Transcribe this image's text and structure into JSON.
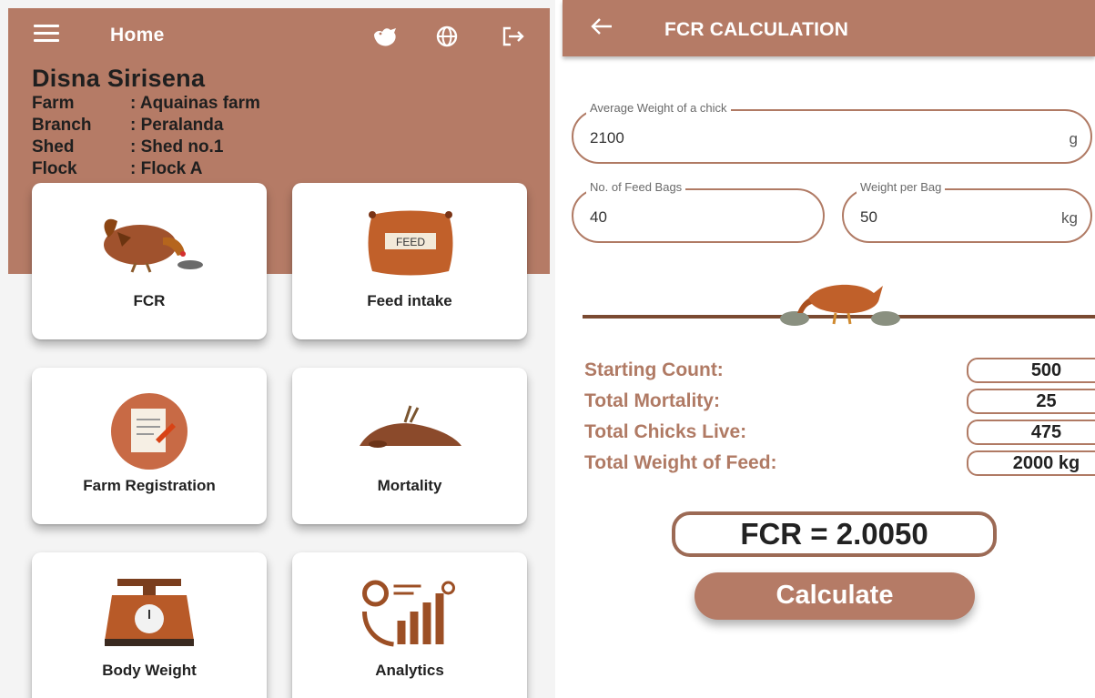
{
  "left_screen": {
    "appbar": {
      "title": "Home"
    },
    "profile": {
      "name": "Disna Sirisena",
      "rows": [
        {
          "key": "Farm",
          "value": ": Aquainas farm"
        },
        {
          "key": "Branch",
          "value": ": Peralanda"
        },
        {
          "key": "Shed",
          "value": ": Shed no.1"
        },
        {
          "key": "Flock",
          "value": ": Flock A"
        }
      ]
    },
    "cards": [
      {
        "label": "FCR",
        "icon": "hen-eating-icon"
      },
      {
        "label": "Feed intake",
        "icon": "feed-bag-icon"
      },
      {
        "label": "Farm Registration",
        "icon": "registration-form-icon"
      },
      {
        "label": "Mortality",
        "icon": "dead-bird-icon"
      },
      {
        "label": "Body Weight",
        "icon": "weighing-scale-icon"
      },
      {
        "label": "Analytics",
        "icon": "analytics-chart-icon"
      }
    ],
    "feed_bag_text": "FEED"
  },
  "right_screen": {
    "appbar": {
      "title": "FCR CALCULATION"
    },
    "fields": {
      "avg_weight": {
        "label": "Average Weight of a chick",
        "value": "2100",
        "unit": "g"
      },
      "feed_bags": {
        "label": "No. of Feed Bags",
        "value": "40"
      },
      "weight_per_bag": {
        "label": "Weight per Bag",
        "value": "50",
        "unit": "kg"
      }
    },
    "stats": [
      {
        "label": "Starting Count:",
        "value": "500"
      },
      {
        "label": "Total Mortality:",
        "value": "25"
      },
      {
        "label": "Total Chicks Live:",
        "value": "475"
      },
      {
        "label": "Total Weight of Feed:",
        "value": "2000 kg"
      }
    ],
    "result": "FCR = 2.0050",
    "calculate_label": "Calculate"
  },
  "colors": {
    "primary": "#b57b66",
    "accent_text": "#b07a64",
    "white": "#ffffff"
  }
}
